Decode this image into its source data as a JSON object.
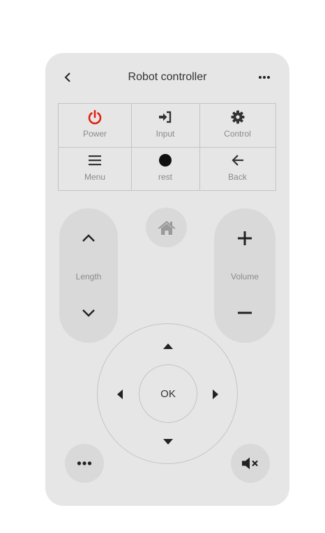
{
  "header": {
    "title": "Robot controller",
    "back_icon": "chevron-left-icon",
    "more_icon": "more-horizontal-icon"
  },
  "grid": {
    "items": [
      {
        "label": "Power",
        "icon": "power-icon",
        "color": "#e02010"
      },
      {
        "label": "Input",
        "icon": "sign-in-icon",
        "color": "#333333"
      },
      {
        "label": "Control",
        "icon": "gear-icon",
        "color": "#333333"
      },
      {
        "label": "Menu",
        "icon": "menu-icon",
        "color": "#333333"
      },
      {
        "label": "rest",
        "icon": "circle-icon",
        "color": "#111111"
      },
      {
        "label": "Back",
        "icon": "arrow-left-icon",
        "color": "#333333"
      }
    ]
  },
  "length": {
    "label": "Length"
  },
  "volume": {
    "label": "Volume"
  },
  "home": {
    "icon": "home-icon"
  },
  "dpad": {
    "ok_label": "OK"
  },
  "footer": {
    "more_icon": "more-horizontal-icon",
    "mute_icon": "volume-mute-icon"
  },
  "colors": {
    "panel": "#e6e6e6",
    "button": "#d9d9d9",
    "accent_power": "#e02010",
    "border": "#c4c4c4"
  }
}
